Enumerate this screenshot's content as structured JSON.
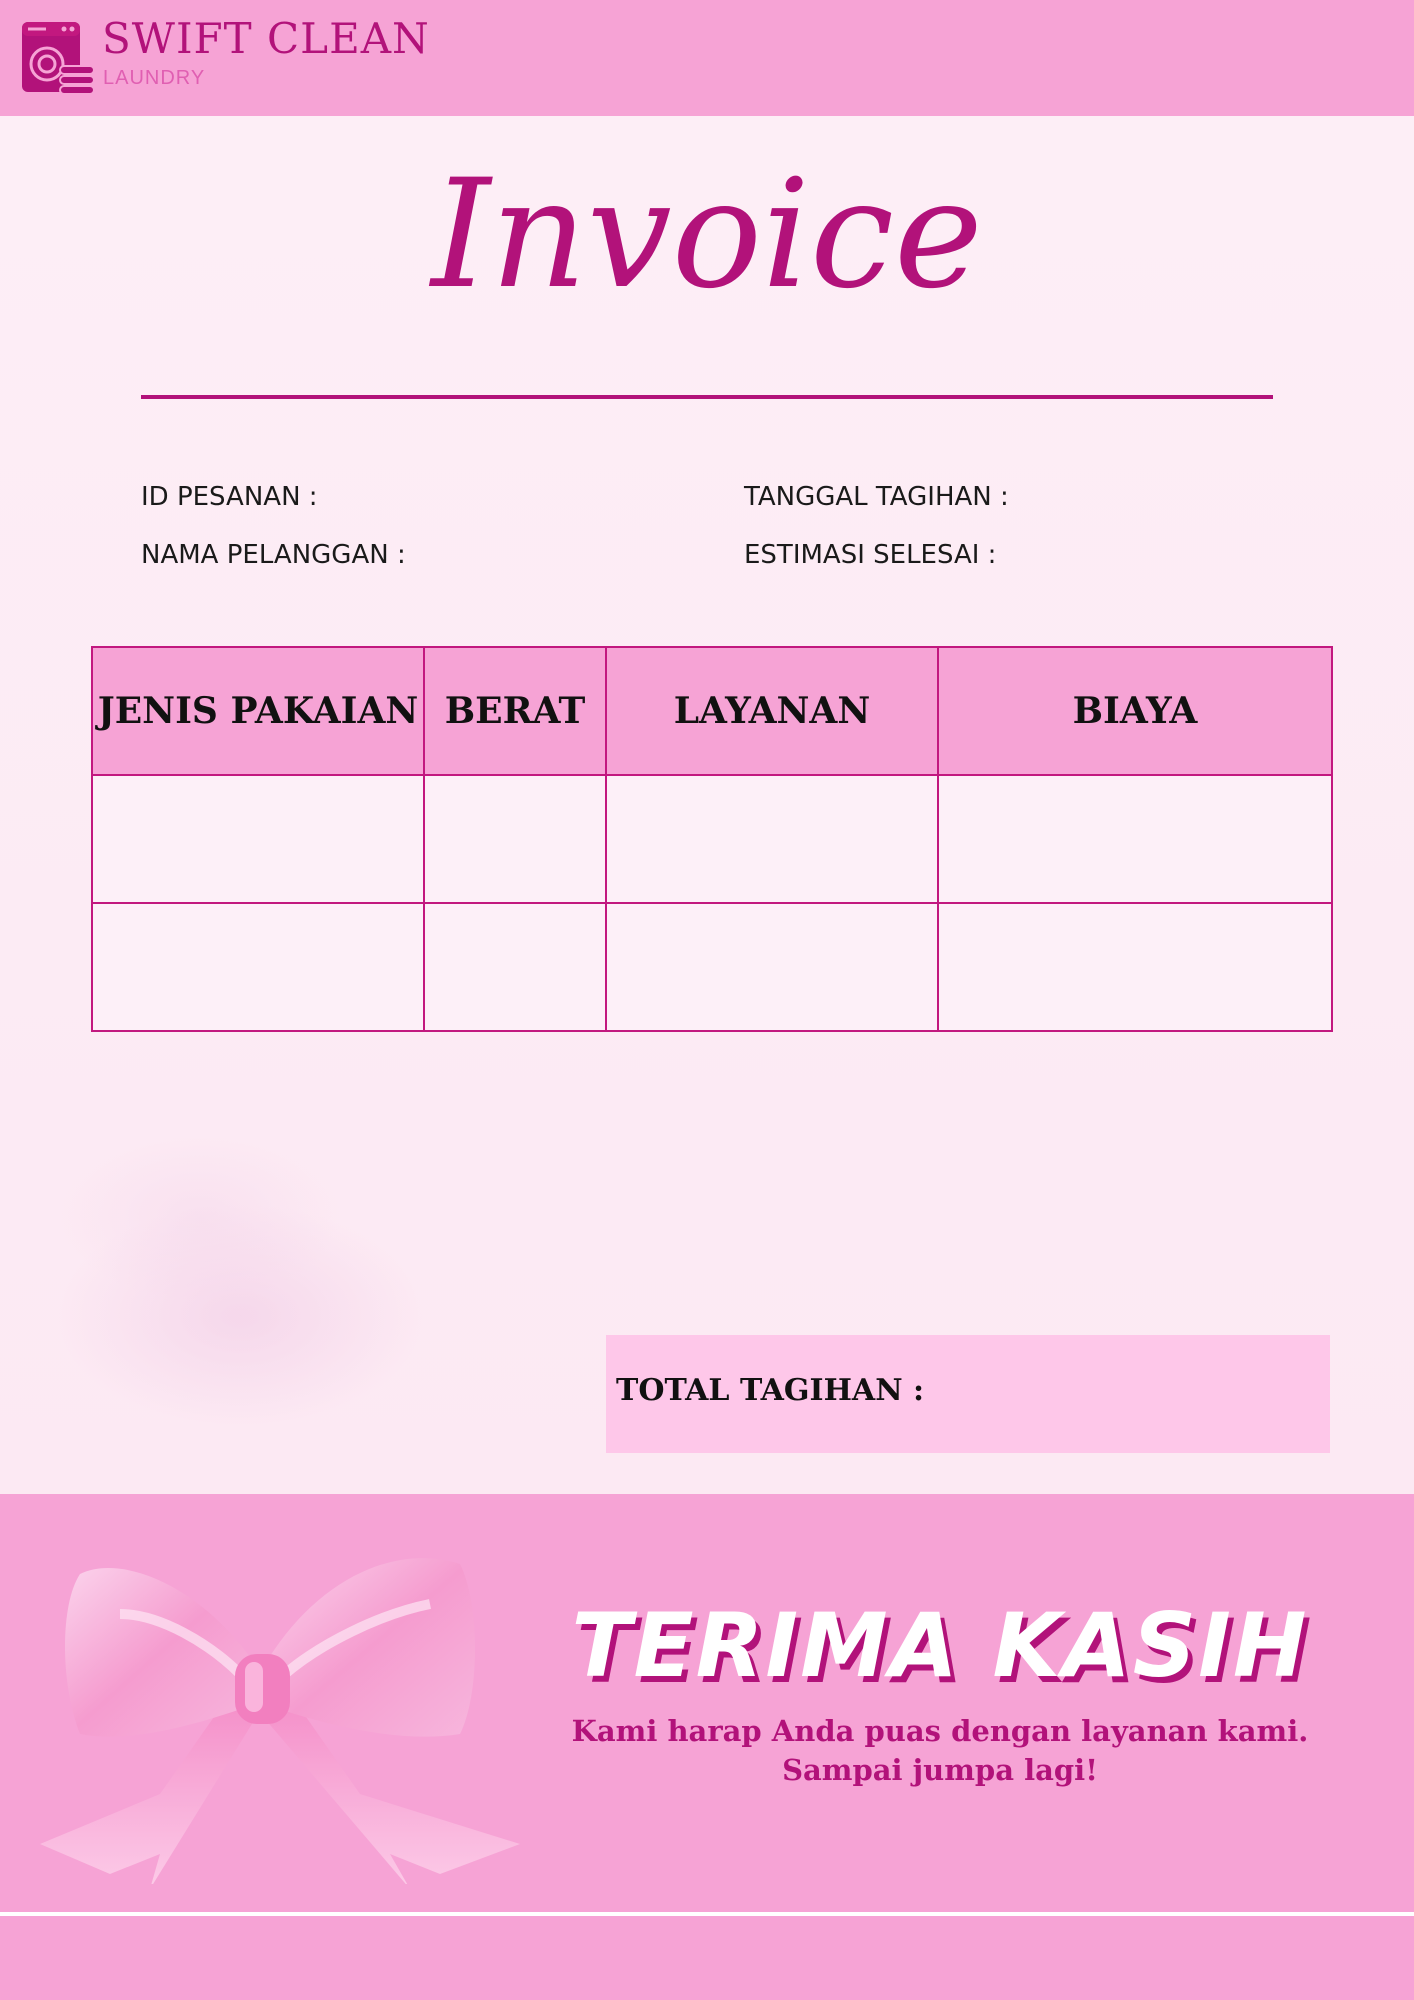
{
  "brand": {
    "name": "SWIFT CLEAN",
    "subtitle": "LAUNDRY",
    "icon": "washing-machine-icon"
  },
  "document": {
    "title": "Invoice"
  },
  "fields": {
    "order_id_label": "ID PESANAN :",
    "customer_name_label": "NAMA PELANGGAN :",
    "invoice_date_label": "TANGGAL TAGIHAN :",
    "estimated_done_label": "ESTIMASI SELESAI :"
  },
  "table": {
    "headers": [
      "JENIS PAKAIAN",
      "BERAT",
      "LAYANAN",
      "BIAYA"
    ],
    "rows": [
      [
        "",
        "",
        "",
        ""
      ],
      [
        "",
        "",
        "",
        ""
      ]
    ]
  },
  "total": {
    "label": "TOTAL TAGIHAN :"
  },
  "footer": {
    "thanks": "TERIMA KASIH",
    "message_line1": "Kami harap Anda puas dengan layanan kami.",
    "message_line2": "Sampai jumpa lagi!",
    "image": "pink-bow-icon"
  },
  "colors": {
    "accent": "#b2127a",
    "header_bg": "#f6a3d5",
    "page_bg": "#fdeef6",
    "total_bg": "#fec7e9"
  }
}
